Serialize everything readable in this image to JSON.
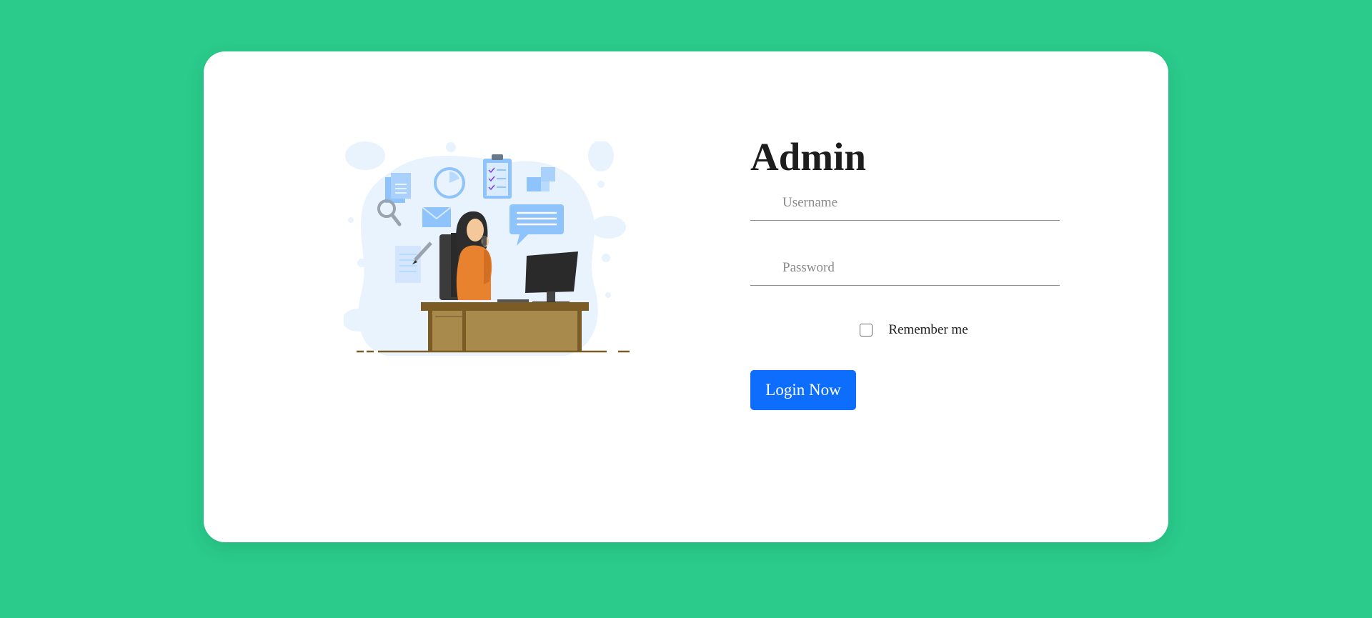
{
  "form": {
    "title": "Admin",
    "username_placeholder": "Username",
    "username_value": "",
    "password_placeholder": "Password",
    "password_value": "",
    "remember_label": "Remember me",
    "remember_checked": false,
    "login_label": "Login Now"
  },
  "illustration": {
    "icon": "woman-at-desk-on-phone-illustration"
  },
  "colors": {
    "background": "#2acb8b",
    "card": "#ffffff",
    "button": "#0d6efd",
    "title": "#1d1d1d"
  }
}
